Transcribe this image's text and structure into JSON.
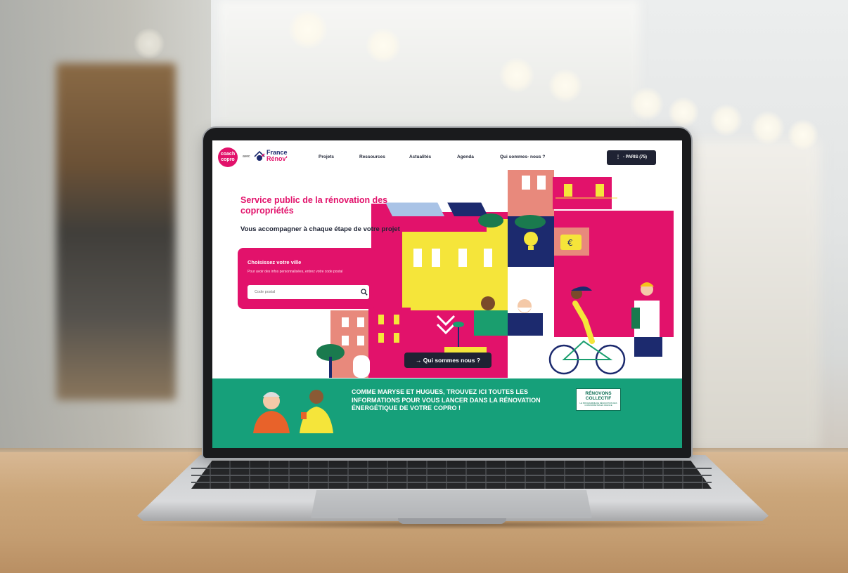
{
  "site": {
    "logo_coach": "coach copro",
    "avec": "avec",
    "france": "France",
    "renov": "Rénov'"
  },
  "nav": {
    "items": [
      {
        "label": "Projets"
      },
      {
        "label": "Ressources"
      },
      {
        "label": "Actualités"
      },
      {
        "label": "Agenda"
      },
      {
        "label": "Qui sommes- nous ?"
      }
    ],
    "city_button": "- PARIS (75)"
  },
  "hero": {
    "title": "Service public de la rénovation des copropriétés",
    "subtitle": "Vous accompagner à chaque étape de votre projet",
    "card": {
      "title": "Choisissez votre ville",
      "text": "Pour avoir des infos personnalisées, entrez votre code postal",
      "input_placeholder": "Code postal"
    },
    "cta": "→ Qui sommes nous ?"
  },
  "banner": {
    "text": "COMME MARYSE ET HUGUES, TROUVEZ ICI TOUTES LES INFORMATIONS POUR VOUS LANCER DANS LA RÉNOVATION ÉNERGÉTIQUE DE VOTRE COPRO !",
    "badge_title": "RÉNOVONS COLLECTIF",
    "badge_sub": "LE PROGRAMME DE RÉNOVATION DES COPROPRIÉTÉS EN FRANCE"
  },
  "colors": {
    "brand_pink": "#e2126b",
    "navy": "#1f2233",
    "green": "#16a07a",
    "yellow": "#f5e53a"
  }
}
